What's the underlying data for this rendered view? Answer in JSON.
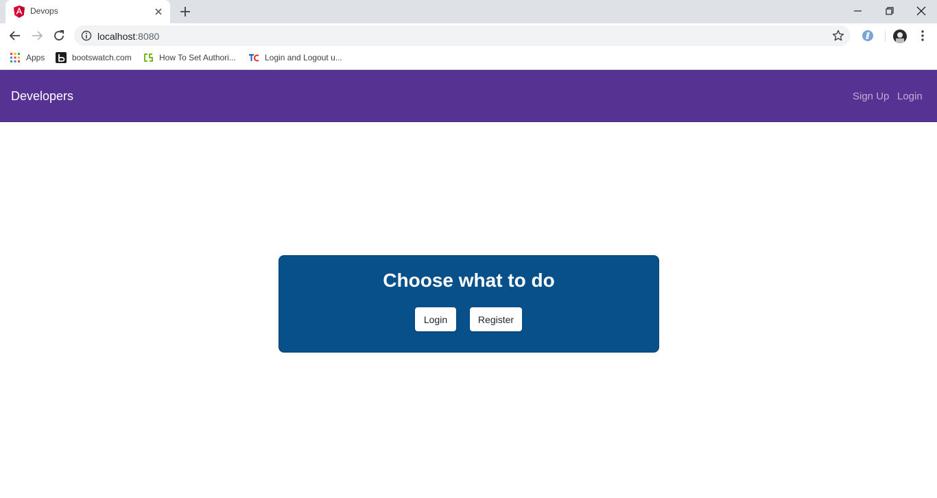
{
  "browser": {
    "tab_title": "Devops",
    "url_host": "localhost",
    "url_port": ":8080",
    "bookmarks": [
      {
        "label": "Apps",
        "icon": "apps-grid-icon"
      },
      {
        "label": "bootswatch.com",
        "icon": "bootswatch-icon"
      },
      {
        "label": "How To Set Authori...",
        "icon": "csharp-corner-icon"
      },
      {
        "label": "Login and Logout u...",
        "icon": "tc-icon"
      }
    ]
  },
  "page": {
    "navbar": {
      "brand": "Developers",
      "links": [
        "Sign Up",
        "Login"
      ],
      "background": "#563293"
    },
    "card": {
      "title": "Choose what to do",
      "buttons": [
        "Login",
        "Register"
      ],
      "background": "#08508a"
    }
  }
}
